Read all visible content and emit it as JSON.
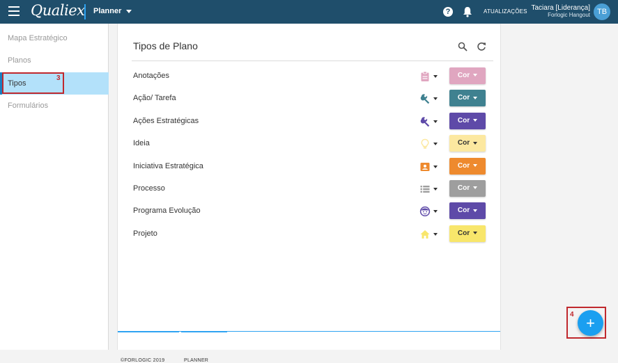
{
  "header": {
    "brand": "Qualiex",
    "app_name": "Planner",
    "updates_label": "ATUALIZAÇÕES",
    "user_name": "Taciara [Liderança]",
    "user_org": "Forlogic Hangout",
    "avatar_initials": "TB"
  },
  "sidebar": {
    "items": [
      {
        "label": "Mapa Estratégico"
      },
      {
        "label": "Planos"
      },
      {
        "label": "Tipos"
      },
      {
        "label": "Formulários"
      }
    ],
    "annotation": "3"
  },
  "panel": {
    "title": "Tipos de Plano",
    "rows": [
      {
        "label": "Anotações",
        "icon": "clipboard-icon",
        "color": "#e0a6c0",
        "text_color": "#ffffff",
        "button": "Cor"
      },
      {
        "label": "Ação/ Tarefa",
        "icon": "wrench-icon",
        "color": "#3f8190",
        "text_color": "#ffffff",
        "button": "Cor"
      },
      {
        "label": "Ações Estratégicas",
        "icon": "wrench-icon",
        "color": "#5e4aa8",
        "text_color": "#ffffff",
        "button": "Cor"
      },
      {
        "label": "Ideia",
        "icon": "lightbulb-icon",
        "color": "#fce8a0",
        "text_color": "#333333",
        "button": "Cor"
      },
      {
        "label": "Iniciativa Estratégica",
        "icon": "contact-card-icon",
        "color": "#ee8a2e",
        "text_color": "#ffffff",
        "button": "Cor"
      },
      {
        "label": "Processo",
        "icon": "list-icon",
        "color": "#9e9e9e",
        "text_color": "#ffffff",
        "button": "Cor"
      },
      {
        "label": "Programa Evolução",
        "icon": "face-icon",
        "color": "#5e4aa8",
        "text_color": "#ffffff",
        "button": "Cor"
      },
      {
        "label": "Projeto",
        "icon": "home-icon",
        "color": "#f8e66b",
        "text_color": "#333333",
        "button": "Cor"
      }
    ]
  },
  "footer": {
    "copyright": "©FORLOGIC 2019",
    "app": "PLANNER"
  },
  "fab": {
    "label": "+",
    "annotation": "4"
  },
  "colors": {
    "topbar": "#1f4e6b",
    "accent": "#2ea3f2",
    "annotation": "#c0282d"
  }
}
